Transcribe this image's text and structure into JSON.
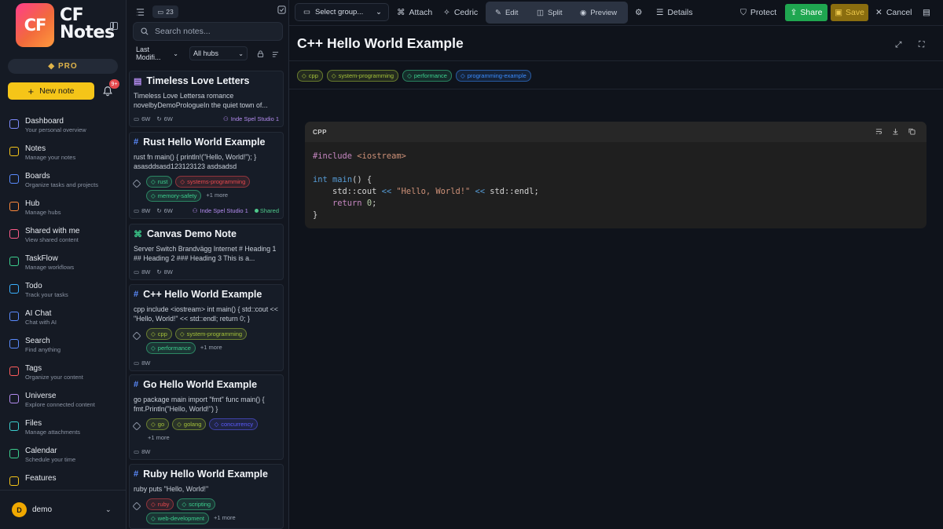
{
  "sidebar": {
    "logo_mark": "CF",
    "logo_line1": "CF",
    "logo_line2": "Notes",
    "pro_label": "PRO",
    "new_note_label": "New note",
    "notif_badge": "9+",
    "nav": [
      {
        "title": "Dashboard",
        "sub": "Your personal overview",
        "icon": "dashboard-icon",
        "color": "#7f8cff"
      },
      {
        "title": "Notes",
        "sub": "Manage your notes",
        "icon": "notes-icon",
        "color": "#f5c518"
      },
      {
        "title": "Boards",
        "sub": "Organize tasks and projects",
        "icon": "boards-icon",
        "color": "#5b8cff"
      },
      {
        "title": "Hub",
        "sub": "Manage hubs",
        "icon": "hub-icon",
        "color": "#ff8a3d"
      },
      {
        "title": "Shared with me",
        "sub": "View shared content",
        "icon": "shared-icon",
        "color": "#ff5c8a"
      },
      {
        "title": "TaskFlow",
        "sub": "Manage workflows",
        "icon": "taskflow-icon",
        "color": "#3ccf8e"
      },
      {
        "title": "Todo",
        "sub": "Track your tasks",
        "icon": "todo-icon",
        "color": "#3ab0ff"
      },
      {
        "title": "AI Chat",
        "sub": "Chat with AI",
        "icon": "ai-chat-icon",
        "color": "#5b8cff"
      },
      {
        "title": "Search",
        "sub": "Find anything",
        "icon": "search-icon",
        "color": "#5b8cff"
      },
      {
        "title": "Tags",
        "sub": "Organize your content",
        "icon": "tag-icon",
        "color": "#ff5c5c"
      },
      {
        "title": "Universe",
        "sub": "Explore connected content",
        "icon": "universe-icon",
        "color": "#b48cf0"
      },
      {
        "title": "Files",
        "sub": "Manage attachments",
        "icon": "files-icon",
        "color": "#3ccfcf"
      },
      {
        "title": "Calendar",
        "sub": "Schedule your time",
        "icon": "calendar-icon",
        "color": "#3ccf8e"
      },
      {
        "title": "Features",
        "sub": "",
        "icon": "lightbulb-icon",
        "color": "#f5c518"
      }
    ],
    "user": {
      "initial": "D",
      "name": "demo"
    }
  },
  "list": {
    "count": "23",
    "search_placeholder": "Search notes...",
    "sort_value": "Last Modifi...",
    "hub_value": "All hubs",
    "cards": [
      {
        "title": "Timeless Love Letters",
        "icon": "document-icon",
        "body": "Timeless Love Lettersa romance novelbyDemoPrologueIn the quiet town of...",
        "tags": [],
        "more": "",
        "age1": "6W",
        "age2": "6W",
        "studio": "Inde Spel Studio 1",
        "shared": ""
      },
      {
        "title": "Rust Hello World Example",
        "icon": "hash-icon",
        "body": "rust fn main() { println!(\"Hello, World!\"); } asasddsasd123123123 asdsadsd",
        "tags": [
          {
            "label": "rust",
            "color": "#3ccf8e"
          },
          {
            "label": "systems-programming",
            "color": "#e5484d"
          },
          {
            "label": "memory-safety",
            "color": "#3ccf8e"
          }
        ],
        "more": "+1 more",
        "age1": "8W",
        "age2": "6W",
        "studio": "Inde Spel Studio 1",
        "shared": "Shared"
      },
      {
        "title": "Canvas Demo Note",
        "icon": "canvas-icon",
        "body": "Server Switch Brandvägg Internet # Heading 1 ## Heading 2 ### Heading 3 This is a...",
        "tags": [],
        "more": "",
        "age1": "8W",
        "age2": "8W",
        "studio": "",
        "shared": ""
      },
      {
        "title": "C++ Hello World Example",
        "icon": "hash-icon",
        "body": "cpp include <iostream> int main() { std::cout << \"Hello, World!\" << std::endl; return 0; }",
        "tags": [
          {
            "label": "cpp",
            "color": "#a3c13a"
          },
          {
            "label": "system-programming",
            "color": "#a3c13a"
          },
          {
            "label": "performance",
            "color": "#3ccf8e"
          }
        ],
        "more": "+1 more",
        "age1": "8W",
        "age2": "",
        "studio": "",
        "shared": ""
      },
      {
        "title": "Go Hello World Example",
        "icon": "hash-icon",
        "body": "go package main import \"fmt\" func main() { fmt.Println(\"Hello, World!\") }",
        "tags": [
          {
            "label": "go",
            "color": "#a3c13a"
          },
          {
            "label": "golang",
            "color": "#a3c13a"
          },
          {
            "label": "concurrency",
            "color": "#5b5bff"
          }
        ],
        "more": "+1 more",
        "age1": "8W",
        "age2": "",
        "studio": "",
        "shared": ""
      },
      {
        "title": "Ruby Hello World Example",
        "icon": "hash-icon",
        "body": "ruby puts \"Hello, World!\"",
        "tags": [
          {
            "label": "ruby",
            "color": "#e5484d"
          },
          {
            "label": "scripting",
            "color": "#3ccf8e"
          },
          {
            "label": "web-development",
            "color": "#3ccf8e"
          }
        ],
        "more": "+1 more",
        "age1": "",
        "age2": "",
        "studio": "",
        "shared": ""
      }
    ]
  },
  "toolbar": {
    "group_select": "Select group...",
    "attach": "Attach",
    "author": "Cedric",
    "edit": "Edit",
    "split": "Split",
    "preview": "Preview",
    "details": "Details",
    "protect": "Protect",
    "share": "Share",
    "save": "Save",
    "cancel": "Cancel"
  },
  "note": {
    "title": "C++ Hello World Example",
    "tags": [
      {
        "label": "cpp",
        "color": "#a3c13a"
      },
      {
        "label": "system-programming",
        "color": "#a3c13a"
      },
      {
        "label": "performance",
        "color": "#3ccf8e"
      },
      {
        "label": "programming-example",
        "color": "#3a8cff"
      }
    ],
    "code_lang": "CPP",
    "code_lines": [
      "#include <iostream>",
      "",
      "int main() {",
      "    std::cout << \"Hello, World!\" << std::endl;",
      "    return 0;",
      "}"
    ]
  }
}
